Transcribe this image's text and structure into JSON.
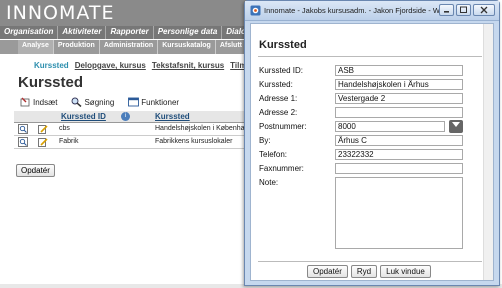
{
  "app": {
    "brand": "INNOMATE",
    "menu": [
      "Organisation",
      "Aktiviteter",
      "Rapporter",
      "Personlige data",
      "Dialo"
    ],
    "submenu": [
      "Analyse",
      "Produktion",
      "Administration",
      "Kursuskatalog",
      "Afslutt"
    ],
    "tabs": [
      "Kurssted",
      "Delopgave, kursus",
      "Tekstafsnit, kursus",
      "Tilmeld"
    ],
    "page_title": "Kurssted",
    "toolbar": {
      "insert": "Indsæt",
      "search": "Søgning",
      "functions": "Funktioner"
    },
    "table": {
      "headers": {
        "id": "Kurssted ID",
        "name": "Kurssted"
      },
      "rows": [
        {
          "id": "cbs",
          "name": "Handelshøjskolen i Københavr"
        },
        {
          "id": "Fabrik",
          "name": "Fabrikkens kursuslokaler"
        }
      ]
    },
    "update_label": "Opdatér"
  },
  "window": {
    "title": "Innomate - Jakobs kursusadm. - Jakon Fjordside - W...",
    "form_title": "Kurssted",
    "fields": {
      "id": {
        "label": "Kurssted ID:",
        "value": "ASB"
      },
      "name": {
        "label": "Kurssted:",
        "value": "Handelshøjskolen i Århus"
      },
      "addr1": {
        "label": "Adresse 1:",
        "value": "Vestergade 2"
      },
      "addr2": {
        "label": "Adresse 2:",
        "value": ""
      },
      "zip": {
        "label": "Postnummer:",
        "value": "8000"
      },
      "city": {
        "label": "By:",
        "value": "Århus C"
      },
      "phone": {
        "label": "Telefon:",
        "value": "23322332"
      },
      "fax": {
        "label": "Faxnummer:",
        "value": ""
      },
      "note": {
        "label": "Note:",
        "value": ""
      }
    },
    "buttons": {
      "update": "Opdatér",
      "reset": "Ryd",
      "close": "Luk vindue"
    }
  },
  "colors": {
    "accent": "#2d8fae",
    "header_link": "#1f4d7a",
    "window_frame": "#c6d8ee"
  }
}
